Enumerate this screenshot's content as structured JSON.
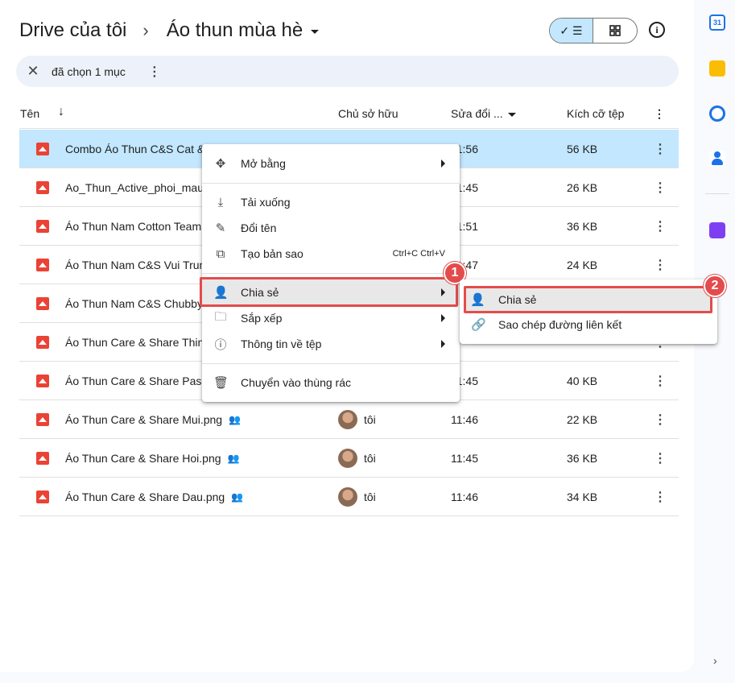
{
  "breadcrumb": {
    "root": "Drive của tôi",
    "separator": "›",
    "current": "Áo thun mùa hè"
  },
  "view_toggle": {
    "list_icon": "✓ ☰",
    "grid_icon": "grid-icon"
  },
  "info_label": "i",
  "selection_bar": {
    "close": "✕",
    "text": "đã chọn 1 mục",
    "more": "⋮"
  },
  "table": {
    "headers": {
      "name": "Tên",
      "sort_arrow": "↓",
      "owner": "Chủ sở hữu",
      "modified": "Sửa đổi ...",
      "size": "Kích cỡ tệp",
      "more": "⋮"
    },
    "rows": [
      {
        "name": "Combo Áo Thun C&S Cat &",
        "owner": "",
        "modified": "11:56",
        "size": "56 KB",
        "shared": false
      },
      {
        "name": "Ao_Thun_Active_phoi_mau",
        "owner": "",
        "modified": "11:45",
        "size": "26 KB",
        "shared": false
      },
      {
        "name": "Áo Thun Nam Cotton Team",
        "owner": "",
        "modified": "11:51",
        "size": "36 KB",
        "shared": false
      },
      {
        "name": "Áo Thun Nam C&S Vui Trun",
        "owner": "",
        "modified": "11:47",
        "size": "24 KB",
        "shared": false
      },
      {
        "name": "Áo Thun Nam C&S Chubby",
        "owner": "",
        "modified": "",
        "size": "",
        "shared": false
      },
      {
        "name": "Áo Thun Care & Share Thin",
        "owner": "",
        "modified": "",
        "size": "",
        "shared": false
      },
      {
        "name": "Áo Thun Care & Share Pas",
        "owner": "",
        "modified": "11:45",
        "size": "40 KB",
        "shared": false
      },
      {
        "name": "Áo Thun Care & Share Mui.png",
        "owner": "tôi",
        "modified": "11:46",
        "size": "22 KB",
        "shared": true
      },
      {
        "name": "Áo Thun Care & Share Hoi.png",
        "owner": "tôi",
        "modified": "11:45",
        "size": "36 KB",
        "shared": true
      },
      {
        "name": "Áo Thun Care & Share Dau.png",
        "owner": "tôi",
        "modified": "11:46",
        "size": "34 KB",
        "shared": true
      }
    ]
  },
  "context_menu": {
    "open_with": "Mở bằng",
    "download": "Tải xuống",
    "rename": "Đổi tên",
    "make_copy": "Tạo bản sao",
    "make_copy_shortcut": "Ctrl+C Ctrl+V",
    "share": "Chia sẻ",
    "organize": "Sắp xếp",
    "file_info": "Thông tin về tệp",
    "trash": "Chuyển vào thùng rác"
  },
  "submenu": {
    "share": "Chia sẻ",
    "copy_link": "Sao chép đường liên kết"
  },
  "badges": {
    "one": "1",
    "two": "2"
  },
  "side_panel": {
    "calendar_label": "31",
    "chevron": "›"
  },
  "colors": {
    "selected_row": "#c2e7ff",
    "highlight": "#e34c4c",
    "file_icon": "#ea4335"
  }
}
